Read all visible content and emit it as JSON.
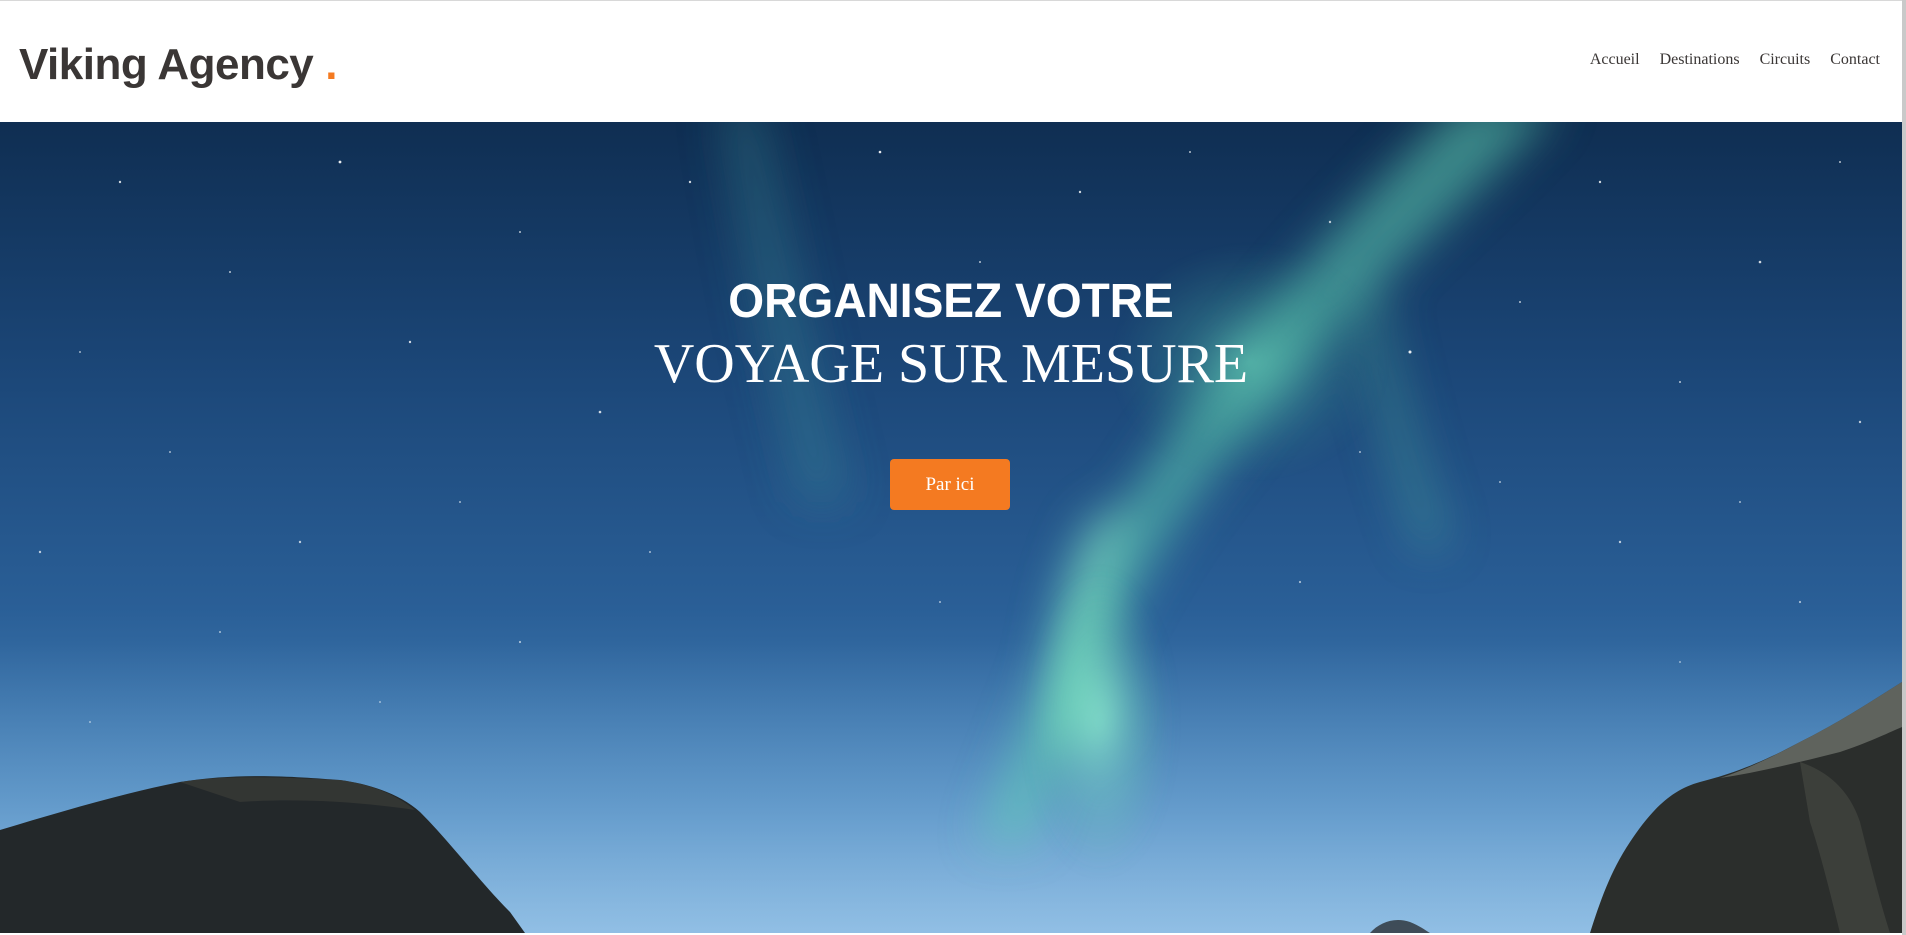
{
  "header": {
    "brand_name": "Viking Agency",
    "brand_dot": ".",
    "nav": [
      {
        "label": "Accueil"
      },
      {
        "label": "Destinations"
      },
      {
        "label": "Circuits"
      },
      {
        "label": "Contact"
      }
    ]
  },
  "hero": {
    "title_line1": "ORGANISEZ VOTRE",
    "title_line2": "VOYAGE SUR MESURE",
    "button_label": "Par ici",
    "image": "northern-lights-mountains-photo"
  },
  "colors": {
    "accent": "#f47a21",
    "text_dark": "#3a3635",
    "sky_top": "#0f2e52",
    "sky_bottom": "#6ea6d3",
    "aurora": "#5fd1b3"
  }
}
